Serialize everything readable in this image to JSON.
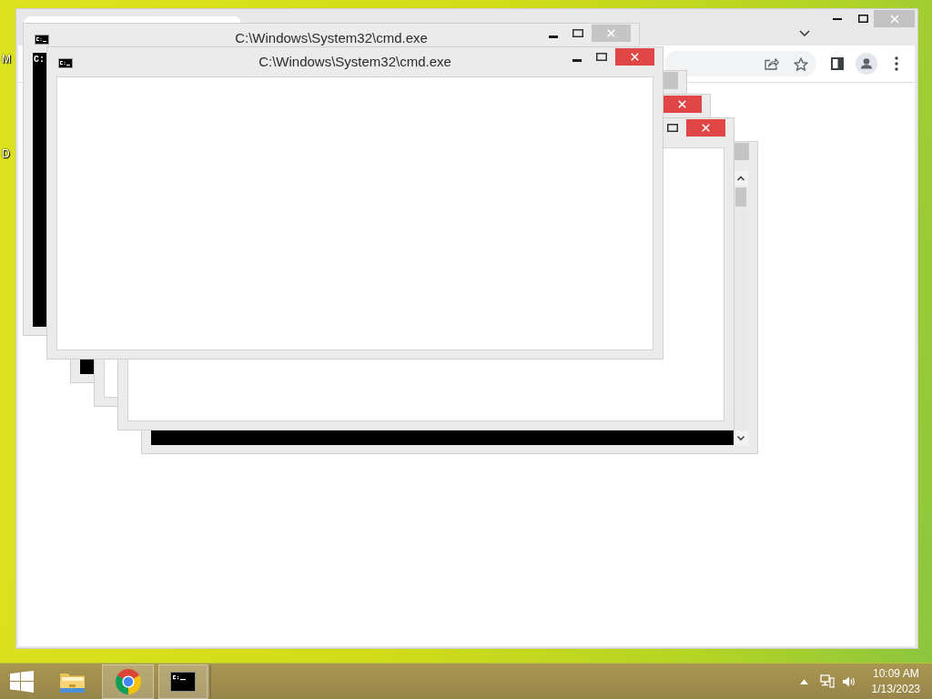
{
  "desktop": {
    "icon_labels": [
      "M",
      "D"
    ]
  },
  "console_windows": [
    {
      "title": "C:\\Windows\\System32\\cmd.exe",
      "close_highlighted": false,
      "console_drawn": true,
      "prompt": "C:",
      "scrollbar": false
    },
    {
      "title": "C:\\Windows\\System32\\cmd.exe",
      "close_highlighted": true,
      "console_drawn": false,
      "scrollbar": false
    },
    {
      "close_highlighted": false,
      "console_drawn": true,
      "scrollbar": false
    },
    {
      "close_highlighted": true,
      "console_drawn": false,
      "scrollbar": false
    },
    {
      "close_highlighted": true,
      "console_drawn": false,
      "scrollbar": false
    },
    {
      "close_highlighted": false,
      "console_drawn": true,
      "scrollbar": true
    }
  ],
  "taskbar": {
    "clock": {
      "time": "10:09 AM",
      "date": "1/13/2023"
    }
  }
}
